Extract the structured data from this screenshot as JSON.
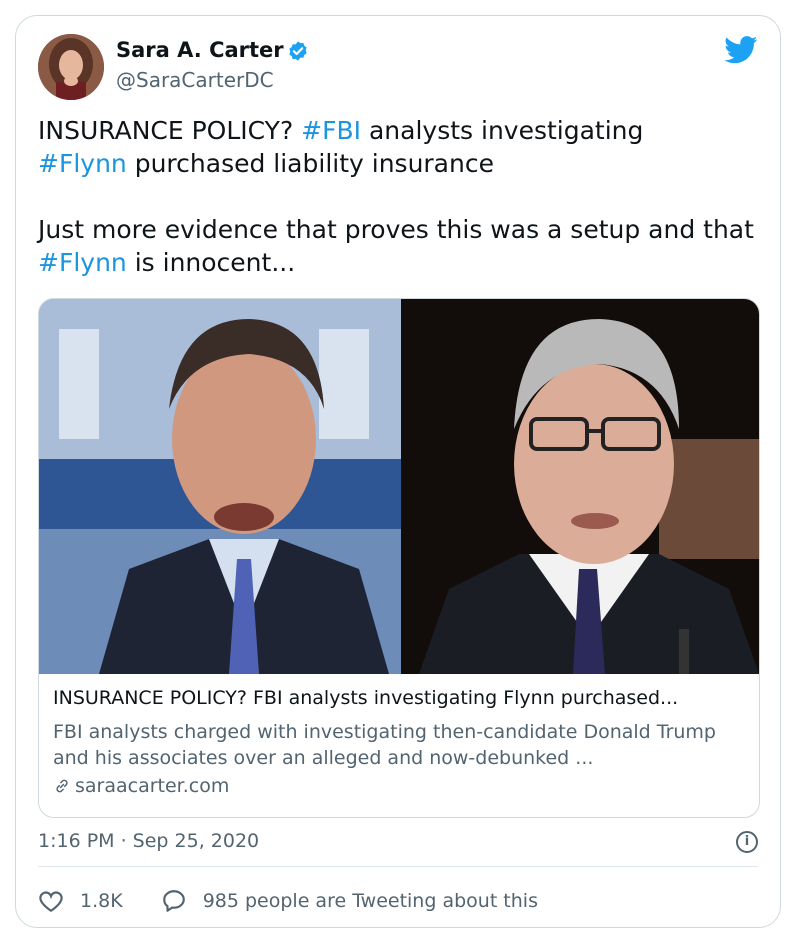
{
  "author": {
    "name": "Sara A. Carter",
    "handle": "@SaraCarterDC"
  },
  "tweet": {
    "line1_prefix": "INSURANCE POLICY? ",
    "hashtag1": "#FBI",
    "line1_suffix": " analysts investigating",
    "hashtag2": "#Flynn",
    "line2_suffix": " purchased liability insurance",
    "para2_prefix": "Just more evidence that proves this was a setup and that ",
    "hashtag3": "#Flynn",
    "para2_suffix": " is innocent..."
  },
  "link_card": {
    "title": "INSURANCE POLICY? FBI analysts investigating Flynn purchased...",
    "description": "FBI analysts charged with investigating then-candidate Donald Trump and his associates over an alleged and now-debunked ...",
    "domain": "saraacarter.com"
  },
  "timestamp": "1:16 PM · Sep 25, 2020",
  "info_icon": "i",
  "actions": {
    "likes": "1.8K",
    "tweeting": "985 people are Tweeting about this"
  },
  "colors": {
    "hashtag": "#1b95e0",
    "verified": "#1da1f2",
    "secondary_text": "#536471"
  }
}
